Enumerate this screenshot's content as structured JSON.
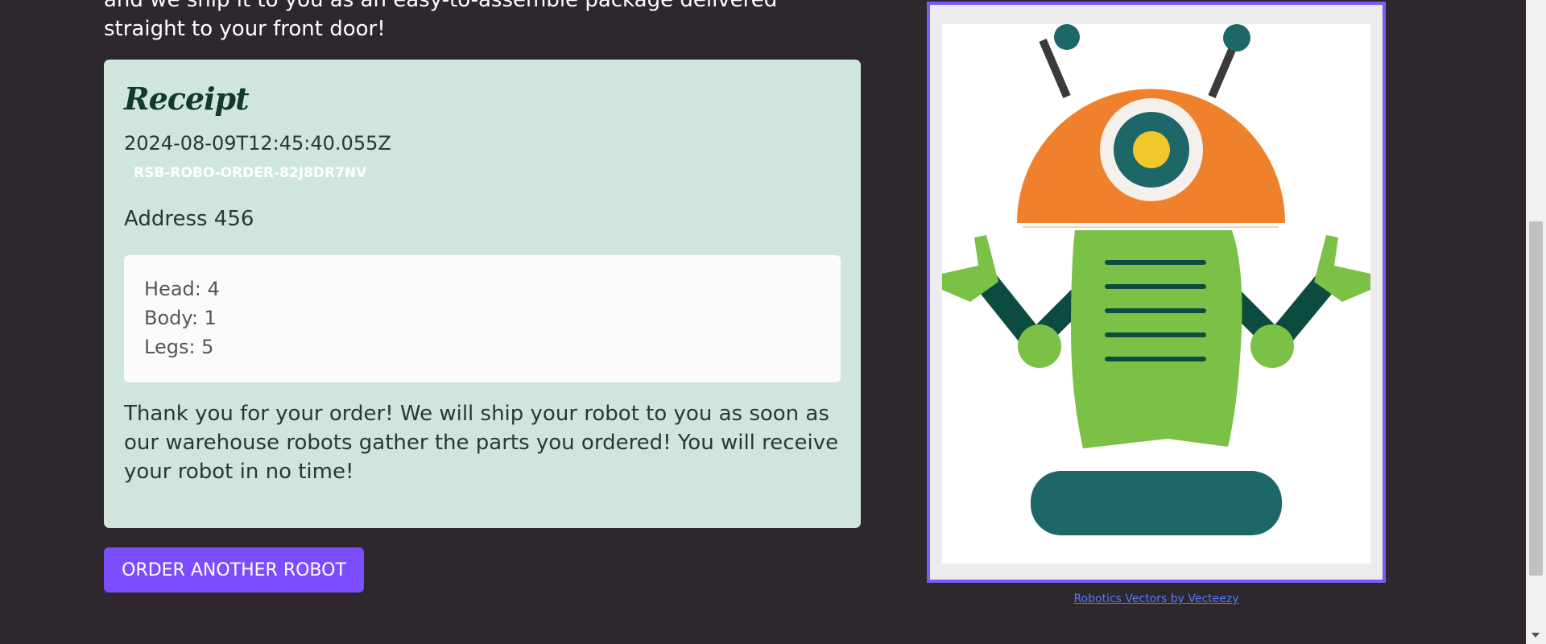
{
  "intro": {
    "text": "and we ship it to you as an easy-to-assemble package delivered straight to your front door!"
  },
  "receipt": {
    "title": "Receipt",
    "timestamp": "2024-08-09T12:45:40.055Z",
    "order_id": "RSB-ROBO-ORDER-82J8DR7NV",
    "address": "Address 456",
    "parts": [
      {
        "label": "Head: 4"
      },
      {
        "label": "Body: 1"
      },
      {
        "label": "Legs: 5"
      }
    ],
    "thanks": "Thank you for your order! We will ship your robot to you as soon as our warehouse robots gather the parts you ordered! You will receive your robot in no time!"
  },
  "order_button": {
    "label": "ORDER ANOTHER ROBOT"
  },
  "robot_image": {
    "credit": "Robotics Vectors by Vecteezy"
  },
  "colors": {
    "background": "#2e272e",
    "receipt_bg": "#d0e6dd",
    "accent": "#7c4dff",
    "robot_orange": "#f0812c",
    "robot_green": "#7bc146",
    "robot_teal": "#1d6769",
    "robot_dark_green": "#0b4b40"
  }
}
